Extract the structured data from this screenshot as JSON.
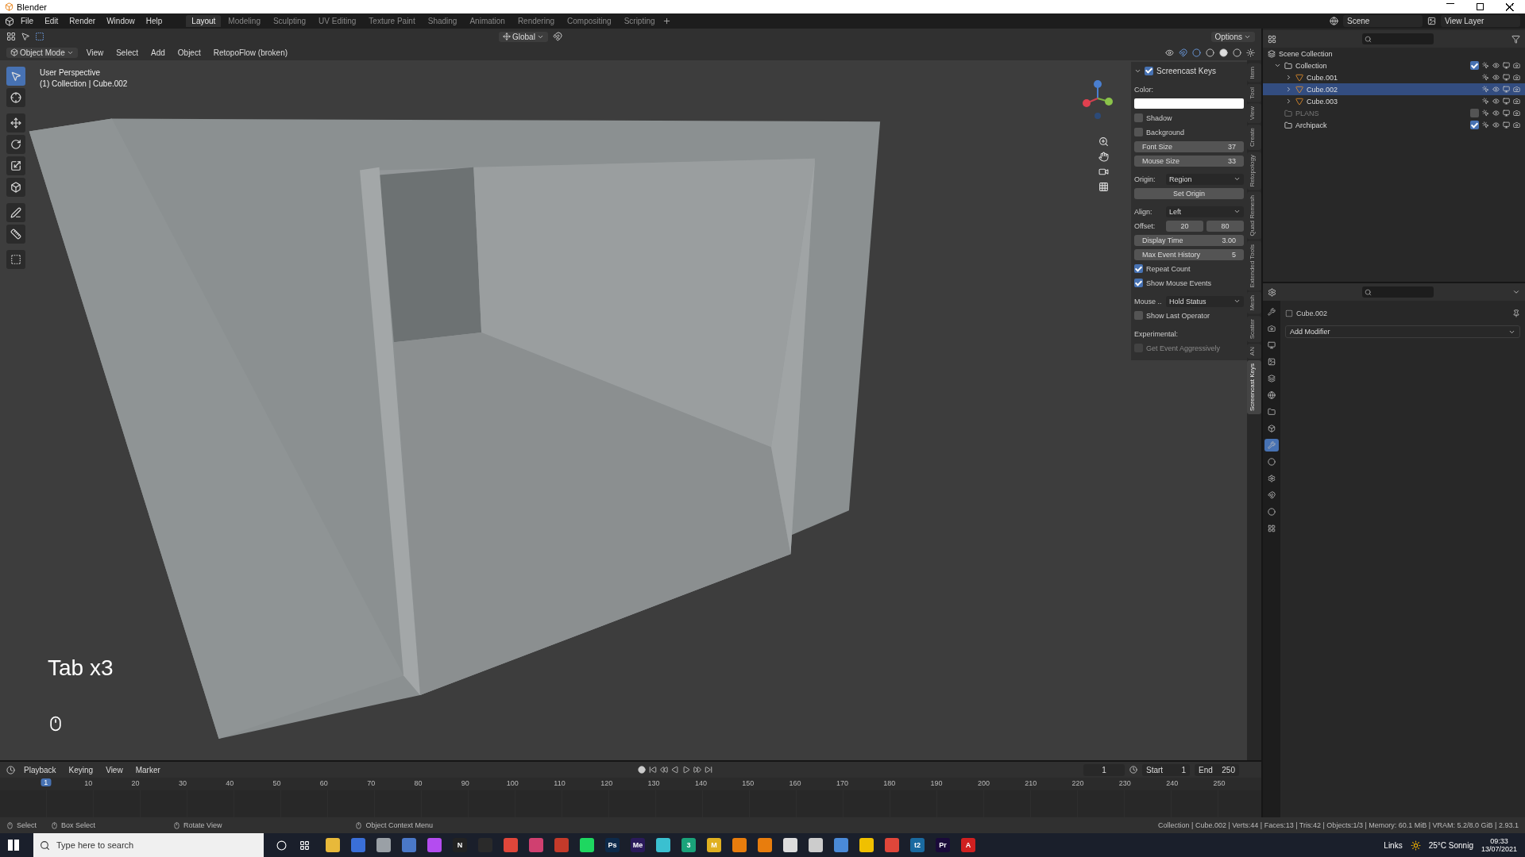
{
  "window": {
    "title": "Blender"
  },
  "menus": [
    "File",
    "Edit",
    "Render",
    "Window",
    "Help"
  ],
  "workspaces": [
    {
      "label": "Layout",
      "selected": true
    },
    {
      "label": "Modeling",
      "selected": false
    },
    {
      "label": "Sculpting",
      "selected": false
    },
    {
      "label": "UV Editing",
      "selected": false
    },
    {
      "label": "Texture Paint",
      "selected": false
    },
    {
      "label": "Shading",
      "selected": false
    },
    {
      "label": "Animation",
      "selected": false
    },
    {
      "label": "Rendering",
      "selected": false
    },
    {
      "label": "Compositing",
      "selected": false
    },
    {
      "label": "Scripting",
      "selected": false
    }
  ],
  "scene": "Scene",
  "view_layer": "View Layer",
  "tool_header": {
    "orientation": "Global",
    "options": "Options"
  },
  "viewport_header": {
    "mode": "Object Mode",
    "menus": [
      "View",
      "Select",
      "Add",
      "Object",
      "RetopoFlow (broken)"
    ]
  },
  "viewport": {
    "perspective": "User Perspective",
    "context": "(1) Collection | Cube.002",
    "overlay_key": "Tab x3"
  },
  "tools": [
    {
      "selected": true
    },
    {
      "selected": false
    },
    {
      "selected": false
    },
    {
      "selected": false
    },
    {
      "selected": false
    },
    {
      "selected": false
    },
    {
      "selected": false
    },
    {
      "selected": false
    },
    {
      "selected": false
    }
  ],
  "n_panel": {
    "title": "Screencast Keys",
    "enabled": true,
    "rows": [
      {
        "kind": "label",
        "text": "Color:"
      },
      {
        "kind": "swatch"
      },
      {
        "kind": "check",
        "label": "Shadow",
        "checked": false,
        "disabled": false
      },
      {
        "kind": "check",
        "label": "Background",
        "checked": false,
        "disabled": false
      },
      {
        "kind": "number",
        "label": "Font Size",
        "value": "37"
      },
      {
        "kind": "number",
        "label": "Mouse Size",
        "value": "33"
      },
      {
        "kind": "select",
        "label": "Origin:",
        "value": "Region"
      },
      {
        "kind": "button",
        "label": "Set Origin"
      },
      {
        "kind": "select",
        "label": "Align:",
        "value": "Left"
      },
      {
        "kind": "pair",
        "label": "Offset:",
        "values": [
          "20",
          "80"
        ]
      },
      {
        "kind": "number",
        "label": "Display Time",
        "value": "3.00"
      },
      {
        "kind": "number",
        "label": "Max Event History",
        "value": "5"
      },
      {
        "kind": "check",
        "label": "Repeat Count",
        "checked": true,
        "disabled": false
      },
      {
        "kind": "check",
        "label": "Show Mouse Events",
        "checked": true,
        "disabled": false
      },
      {
        "kind": "select",
        "label": "Mouse ..",
        "value": "Hold Status"
      },
      {
        "kind": "check",
        "label": "Show Last Operator",
        "checked": false,
        "disabled": false
      },
      {
        "kind": "label",
        "text": "Experimental:"
      },
      {
        "kind": "check",
        "label": "Get Event Aggressively",
        "checked": false,
        "disabled": true
      }
    ]
  },
  "sidebar_tabs": [
    {
      "label": "Item",
      "selected": false
    },
    {
      "label": "Tool",
      "selected": false
    },
    {
      "label": "View",
      "selected": false
    },
    {
      "label": "Create",
      "selected": false
    },
    {
      "label": "Retopology",
      "selected": false
    },
    {
      "label": "Quad Remesh",
      "selected": false
    },
    {
      "label": "Extended Tools",
      "selected": false
    },
    {
      "label": "Mesh",
      "selected": false
    },
    {
      "label": "Scatter",
      "selected": false
    },
    {
      "label": "AN",
      "selected": false
    },
    {
      "label": "Screencast Keys",
      "selected": true
    }
  ],
  "outliner": {
    "root": "Scene Collection",
    "items": [
      {
        "name": "Collection",
        "kind": "collection",
        "expanded": true,
        "included": true,
        "selected": false,
        "children": [
          {
            "name": "Cube.001",
            "kind": "mesh",
            "selected": false
          },
          {
            "name": "Cube.002",
            "kind": "mesh",
            "selected": true
          },
          {
            "name": "Cube.003",
            "kind": "mesh",
            "selected": false
          }
        ]
      },
      {
        "name": "PLANS",
        "kind": "collection",
        "included": false,
        "selected": false
      },
      {
        "name": "Archipack",
        "kind": "collection",
        "included": true,
        "selected": false
      }
    ]
  },
  "properties": {
    "object": "Cube.002",
    "add_modifier": "Add Modifier",
    "tabs": [
      {
        "selected": false
      },
      {
        "selected": false
      },
      {
        "selected": false
      },
      {
        "selected": false
      },
      {
        "selected": false
      },
      {
        "selected": false
      },
      {
        "selected": false
      },
      {
        "selected": false
      },
      {
        "selected": true
      },
      {
        "selected": false
      },
      {
        "selected": false
      },
      {
        "selected": false
      },
      {
        "selected": false
      },
      {
        "selected": false
      }
    ]
  },
  "timeline": {
    "menus": [
      "Playback",
      "Keying",
      "View",
      "Marker"
    ],
    "current_frame": "1",
    "frame_field": "1",
    "start_label": "Start",
    "start": "1",
    "end_label": "End",
    "end": "250",
    "ruler": [
      "10",
      "20",
      "30",
      "40",
      "50",
      "60",
      "70",
      "80",
      "90",
      "100",
      "110",
      "120",
      "130",
      "140",
      "150",
      "160",
      "170",
      "180",
      "190",
      "200",
      "210",
      "220",
      "230",
      "240",
      "250"
    ]
  },
  "status_bar": {
    "hints": [
      "Select",
      "Box Select",
      "Rotate View",
      "Object Context Menu"
    ],
    "stats": "Collection | Cube.002 | Verts:44 | Faces:13 | Tris:42 | Objects:1/3 | Memory: 60.1 MiB | VRAM: 5.2/8.0 GiB | 2.93.1"
  },
  "taskbar": {
    "search_placeholder": "Type here to search",
    "apps": [
      {
        "color": "#e8b93a"
      },
      {
        "color": "#3a6fd8"
      },
      {
        "color": "#9aa0a6"
      },
      {
        "color": "#4a78c8"
      },
      {
        "color": "#b44cf0"
      },
      {
        "color": "#222222",
        "label": "N"
      },
      {
        "color": "#2a2a2a"
      },
      {
        "color": "#e0463a"
      },
      {
        "color": "#d04070"
      },
      {
        "color": "#c43a2a"
      },
      {
        "color": "#1ed760"
      },
      {
        "color": "#0d2a4a",
        "label": "Ps"
      },
      {
        "color": "#2a1a5a",
        "label": "Me"
      },
      {
        "color": "#3ac0d0"
      },
      {
        "color": "#1aa37a",
        "label": "3"
      },
      {
        "color": "#e0b020",
        "label": "M"
      },
      {
        "color": "#e87d0d"
      },
      {
        "color": "#e87d0d"
      },
      {
        "color": "#dddddd"
      },
      {
        "color": "#cccccc"
      },
      {
        "color": "#4a8ad8"
      },
      {
        "color": "#f0c000"
      },
      {
        "color": "#e0463a"
      },
      {
        "color": "#1a6aa0",
        "label": "t2"
      },
      {
        "color": "#1a0a3a",
        "label": "Pr"
      },
      {
        "color": "#d02020",
        "label": "A"
      }
    ],
    "links": "Links",
    "weather": "25°C Sonnig",
    "time": "09:33",
    "date": "13/07/2021"
  }
}
